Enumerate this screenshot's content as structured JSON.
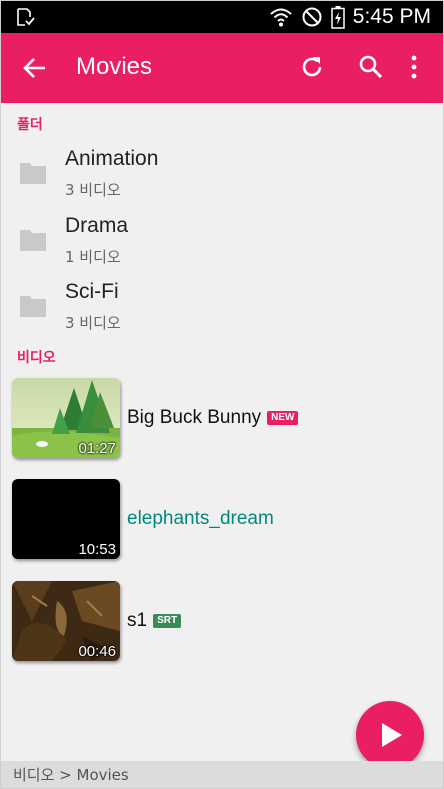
{
  "status_bar": {
    "time": "5:45 PM"
  },
  "toolbar": {
    "title": "Movies",
    "color": "#e91e63"
  },
  "folders_section": {
    "header": "폴더",
    "items": [
      {
        "name": "Animation",
        "count": "3 비디오",
        "icon": "folder-icon"
      },
      {
        "name": "Drama",
        "count": "1 비디오",
        "icon": "folder-icon"
      },
      {
        "name": "Sci-Fi",
        "count": "3 비디오",
        "icon": "folder-icon"
      }
    ]
  },
  "videos_section": {
    "header": "비디오",
    "items": [
      {
        "title": "Big Buck Bunny",
        "duration": "01:27",
        "badge": "NEW",
        "badge_color": "#e91e63",
        "title_color": "#111111"
      },
      {
        "title": "elephants_dream",
        "duration": "10:53",
        "badge": "",
        "title_color": "#00897b"
      },
      {
        "title": "s1",
        "duration": "00:46",
        "badge": "SRT",
        "badge_color": "#3a8a5a",
        "title_color": "#111111"
      }
    ]
  },
  "fab": {
    "icon": "play-icon"
  },
  "breadcrumb": {
    "text": "비디오 > Movies"
  }
}
